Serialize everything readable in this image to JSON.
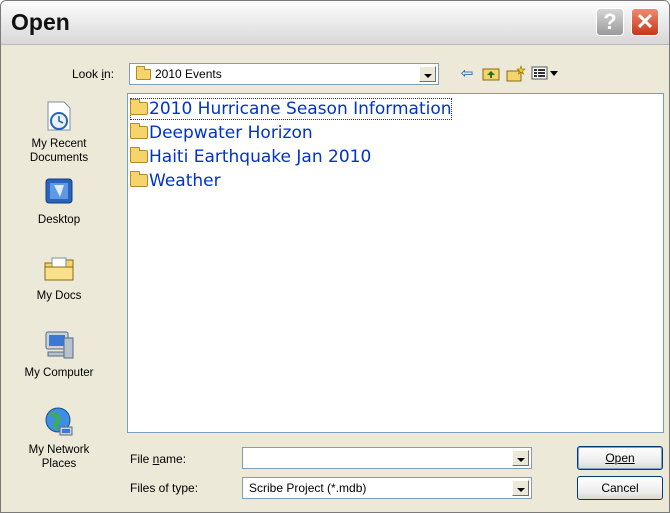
{
  "window": {
    "title": "Open",
    "help_label": "?",
    "close_label": "✕"
  },
  "toolbar": {
    "look_in_label": "Look in:",
    "look_in_value": "2010 Events"
  },
  "places": [
    {
      "label_line1": "My Recent",
      "label_line2": "Documents",
      "icon": "recent-documents-icon"
    },
    {
      "label_line1": "Desktop",
      "label_line2": "",
      "icon": "desktop-icon"
    },
    {
      "label_line1": "My Docs",
      "label_line2": "",
      "icon": "my-docs-icon"
    },
    {
      "label_line1": "My Computer",
      "label_line2": "",
      "icon": "computer-icon"
    },
    {
      "label_line1": "My Network",
      "label_line2": "Places",
      "icon": "network-icon"
    }
  ],
  "files": [
    {
      "name": "2010 Hurricane Season Information",
      "selected": true
    },
    {
      "name": "Deepwater Horizon",
      "selected": false
    },
    {
      "name": "Haiti Earthquake Jan 2010",
      "selected": false
    },
    {
      "name": "Weather",
      "selected": false
    }
  ],
  "form": {
    "file_name_label": "File name:",
    "file_name_value": "",
    "file_type_label": "Files of type:",
    "file_type_value": "Scribe Project (*.mdb)"
  },
  "buttons": {
    "open": "Open",
    "cancel": "Cancel"
  }
}
